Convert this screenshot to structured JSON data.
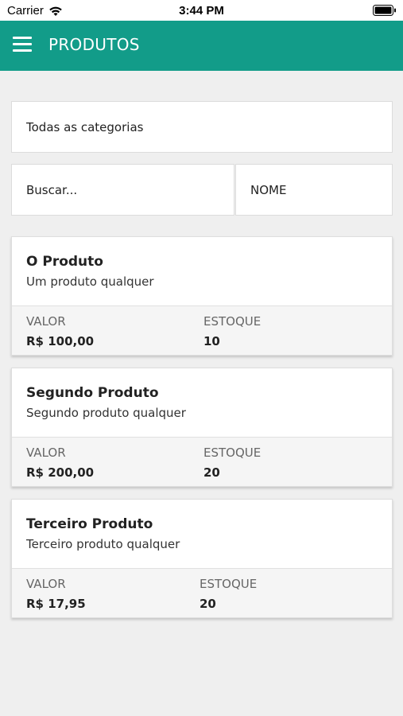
{
  "status_bar": {
    "carrier": "Carrier",
    "time": "3:44 PM"
  },
  "app_bar": {
    "title": "PRODUTOS",
    "color": "#129c89"
  },
  "filters": {
    "category": "Todas as categorias",
    "search_placeholder": "Buscar...",
    "sort_by": "NOME"
  },
  "labels": {
    "price": "VALOR",
    "stock": "ESTOQUE"
  },
  "products": [
    {
      "name": "O Produto",
      "description": "Um produto qualquer",
      "price": "R$ 100,00",
      "stock": "10"
    },
    {
      "name": "Segundo Produto",
      "description": "Segundo produto qualquer",
      "price": "R$ 200,00",
      "stock": "20"
    },
    {
      "name": "Terceiro Produto",
      "description": "Terceiro produto qualquer",
      "price": "R$ 17,95",
      "stock": "20"
    }
  ]
}
